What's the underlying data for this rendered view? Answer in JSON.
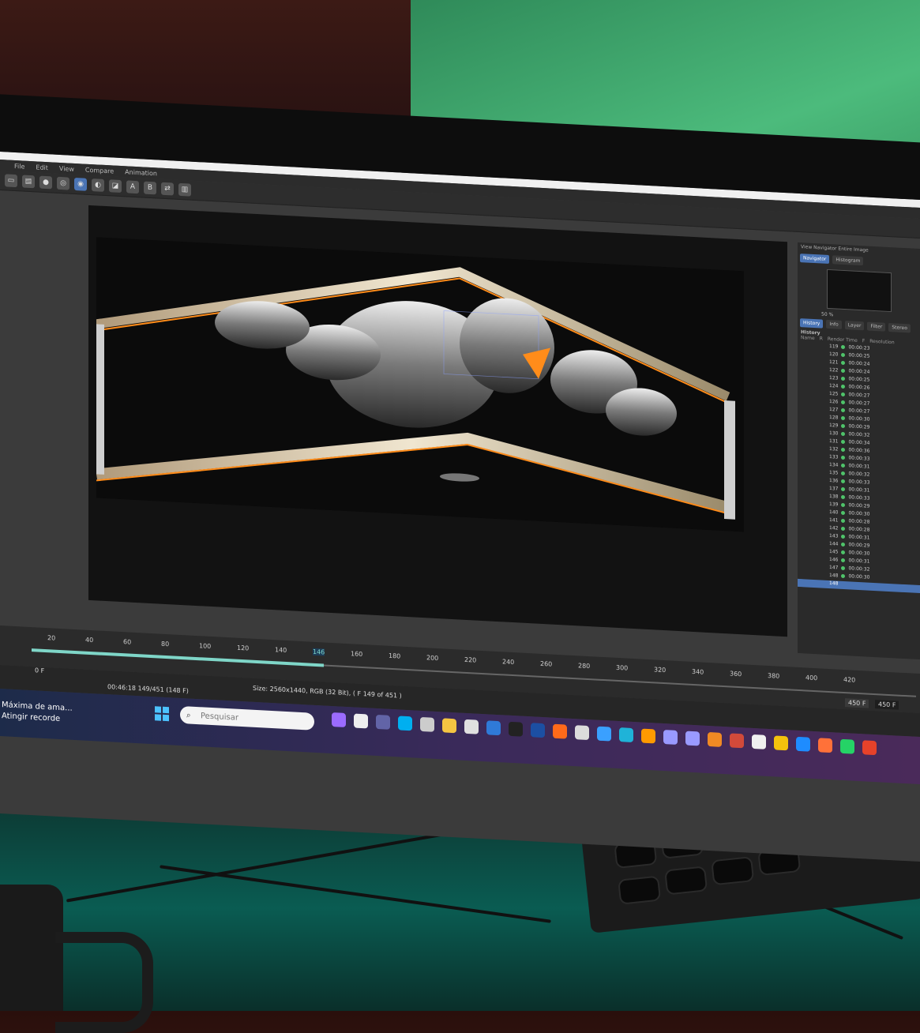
{
  "menu": {
    "items": [
      "File",
      "Edit",
      "View",
      "Compare",
      "Animation"
    ]
  },
  "toolbar": {
    "a_label": "A",
    "b_label": "B"
  },
  "right_panel": {
    "header": "View Navigator  Entire Image",
    "tabs": [
      "Navigator",
      "Histogram"
    ],
    "zoom": "50 %",
    "sub_tabs": [
      "History",
      "Info",
      "Layer",
      "Filter",
      "Stereo"
    ],
    "section_title": "History",
    "columns": [
      "Name",
      "R",
      "Render Time",
      "F",
      "Resolution"
    ],
    "rows": [
      {
        "n": "119",
        "time": "00:00:23"
      },
      {
        "n": "120",
        "time": "00:00:25"
      },
      {
        "n": "121",
        "time": "00:00:24"
      },
      {
        "n": "122",
        "time": "00:00:24"
      },
      {
        "n": "123",
        "time": "00:00:25"
      },
      {
        "n": "124",
        "time": "00:00:26"
      },
      {
        "n": "125",
        "time": "00:00:27"
      },
      {
        "n": "126",
        "time": "00:00:27"
      },
      {
        "n": "127",
        "time": "00:00:27"
      },
      {
        "n": "128",
        "time": "00:00:30"
      },
      {
        "n": "129",
        "time": "00:00:29"
      },
      {
        "n": "130",
        "time": "00:00:32"
      },
      {
        "n": "131",
        "time": "00:00:34"
      },
      {
        "n": "132",
        "time": "00:00:36"
      },
      {
        "n": "133",
        "time": "00:00:33"
      },
      {
        "n": "134",
        "time": "00:00:31"
      },
      {
        "n": "135",
        "time": "00:00:32"
      },
      {
        "n": "136",
        "time": "00:00:33"
      },
      {
        "n": "137",
        "time": "00:00:31"
      },
      {
        "n": "138",
        "time": "00:00:33"
      },
      {
        "n": "139",
        "time": "00:00:29"
      },
      {
        "n": "140",
        "time": "00:00:30"
      },
      {
        "n": "141",
        "time": "00:00:28"
      },
      {
        "n": "142",
        "time": "00:00:28"
      },
      {
        "n": "143",
        "time": "00:00:31"
      },
      {
        "n": "144",
        "time": "00:00:29"
      },
      {
        "n": "145",
        "time": "00:00:30"
      },
      {
        "n": "146",
        "time": "00:00:31"
      },
      {
        "n": "147",
        "time": "00:00:32"
      },
      {
        "n": "148",
        "time": "00:00:30"
      }
    ],
    "current_row": "148"
  },
  "timeline": {
    "ticks": [
      "20",
      "40",
      "60",
      "80",
      "100",
      "120",
      "140",
      "146",
      "160",
      "180",
      "200",
      "220",
      "240",
      "260",
      "280",
      "300",
      "320",
      "340",
      "360",
      "380",
      "400",
      "420"
    ],
    "current_frame": "146",
    "progress": 0.33,
    "start_field": "0 F",
    "end_field": "450 F",
    "end_field2": "450 F"
  },
  "status": {
    "elapsed": "00:46:18 149/451 (148 F)",
    "info": "Size: 2560x1440, RGB (32 Bit),  ( F 149 of 451 )"
  },
  "taskbar": {
    "news_line1": "Máxima de ama...",
    "news_line2": "Atingir recorde",
    "search_placeholder": "Pesquisar",
    "icons": [
      {
        "name": "copilot-icon",
        "color": "#9b6bff"
      },
      {
        "name": "task-view-icon",
        "color": "#eeeeee"
      },
      {
        "name": "teams-icon",
        "color": "#6264a7"
      },
      {
        "name": "skype-icon",
        "color": "#00aff0"
      },
      {
        "name": "settings-icon",
        "color": "#cccccc"
      },
      {
        "name": "file-explorer-icon",
        "color": "#f4c542"
      },
      {
        "name": "store-icon",
        "color": "#e0e0e0"
      },
      {
        "name": "mail-icon",
        "color": "#2f7ad8"
      },
      {
        "name": "epic-games-icon",
        "color": "#222222"
      },
      {
        "name": "cinema4d-icon",
        "color": "#1c4fa3"
      },
      {
        "name": "houdini-icon",
        "color": "#ff6a1a"
      },
      {
        "name": "notepad-icon",
        "color": "#dcdcdc"
      },
      {
        "name": "browser-icon",
        "color": "#3aa0ff"
      },
      {
        "name": "edge-icon",
        "color": "#1fb3d8"
      },
      {
        "name": "illustrator-icon",
        "color": "#ff9a00"
      },
      {
        "name": "after-effects-icon",
        "color": "#9999ff"
      },
      {
        "name": "premiere-icon",
        "color": "#9a9aff"
      },
      {
        "name": "blender-icon",
        "color": "#f08a24"
      },
      {
        "name": "daz-studio-icon",
        "color": "#d24a3a"
      },
      {
        "name": "photos-icon",
        "color": "#f0f0f0"
      },
      {
        "name": "chrome-icon",
        "color": "#f4c20d"
      },
      {
        "name": "zoom-icon",
        "color": "#1e8cff"
      },
      {
        "name": "firefox-icon",
        "color": "#ff7139"
      },
      {
        "name": "whatsapp-icon",
        "color": "#25d366"
      },
      {
        "name": "media-player-icon",
        "color": "#e6422a"
      }
    ]
  }
}
